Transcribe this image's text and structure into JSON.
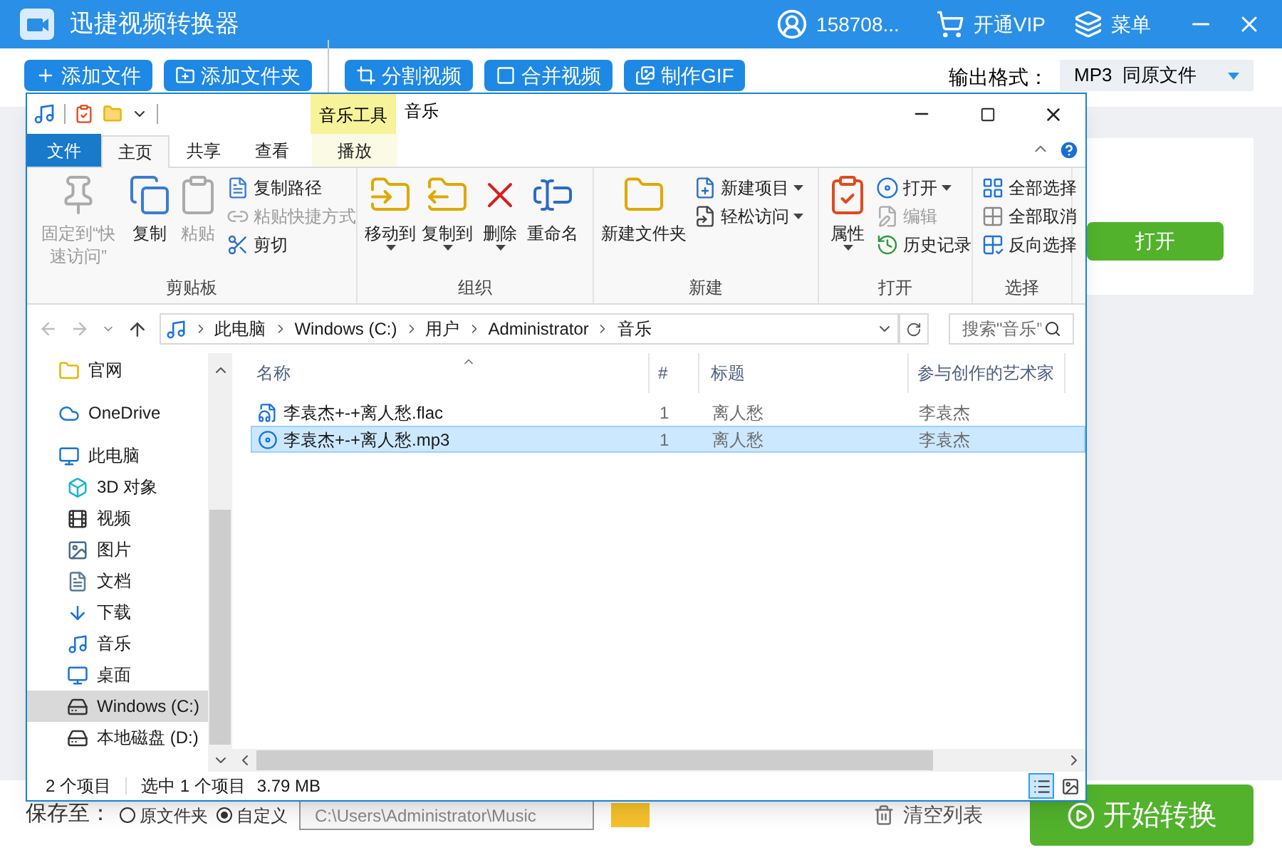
{
  "app": {
    "title": "迅捷视频转换器",
    "user": "158708...",
    "vip": "开通VIP",
    "menu": "菜单",
    "toolbar": [
      "添加文件",
      "添加文件夹",
      "分割视频",
      "合并视频",
      "制作GIF"
    ],
    "output_format": {
      "label": "输出格式：",
      "value": "MP3  同原文件"
    },
    "open_button": "打开",
    "save": {
      "label": "保存至：",
      "options": [
        {
          "label": "原文件夹",
          "selected": false
        },
        {
          "label": "自定义",
          "selected": true
        }
      ],
      "path": "C:\\Users\\Administrator\\Music"
    },
    "clear": "清空列表",
    "start": "开始转换"
  },
  "explorer": {
    "context_tab": "音乐工具",
    "title": "音乐",
    "tabs": [
      {
        "label": "文件",
        "kind": "file",
        "selected": false
      },
      {
        "label": "主页",
        "kind": "tab",
        "selected": true
      },
      {
        "label": "共享",
        "kind": "tab",
        "selected": false
      },
      {
        "label": "查看",
        "kind": "tab",
        "selected": false
      },
      {
        "label": "播放",
        "kind": "context",
        "selected": false
      }
    ],
    "ribbon": [
      {
        "label": "剪贴板",
        "items": [
          {
            "label": "固定到“快速访问”",
            "kind": "large",
            "disabled": true,
            "dropdown": false
          },
          {
            "label": "复制",
            "kind": "large",
            "disabled": false,
            "dropdown": false
          },
          {
            "label": "粘贴",
            "kind": "large",
            "disabled": true,
            "dropdown": false
          },
          {
            "label": "复制路径",
            "kind": "small",
            "disabled": false,
            "dropdown": false
          },
          {
            "label": "粘贴快捷方式",
            "kind": "small",
            "disabled": true,
            "dropdown": false
          },
          {
            "label": "剪切",
            "kind": "small",
            "disabled": false,
            "dropdown": false
          }
        ]
      },
      {
        "label": "组织",
        "items": [
          {
            "label": "移动到",
            "kind": "large",
            "disabled": false,
            "dropdown": true
          },
          {
            "label": "复制到",
            "kind": "large",
            "disabled": false,
            "dropdown": true
          },
          {
            "label": "删除",
            "kind": "large",
            "disabled": false,
            "dropdown": true
          },
          {
            "label": "重命名",
            "kind": "large",
            "disabled": false,
            "dropdown": false
          }
        ]
      },
      {
        "label": "新建",
        "items": [
          {
            "label": "新建文件夹",
            "kind": "large",
            "disabled": false,
            "dropdown": false
          },
          {
            "label": "新建项目",
            "kind": "small",
            "disabled": false,
            "dropdown": true
          },
          {
            "label": "轻松访问",
            "kind": "small",
            "disabled": false,
            "dropdown": true
          }
        ]
      },
      {
        "label": "打开",
        "items": [
          {
            "label": "属性",
            "kind": "large",
            "disabled": false,
            "dropdown": true
          },
          {
            "label": "打开",
            "kind": "small",
            "disabled": false,
            "dropdown": true
          },
          {
            "label": "编辑",
            "kind": "small",
            "disabled": true,
            "dropdown": false
          },
          {
            "label": "历史记录",
            "kind": "small",
            "disabled": false,
            "dropdown": false
          }
        ]
      },
      {
        "label": "选择",
        "items": [
          {
            "label": "全部选择",
            "kind": "small",
            "disabled": false,
            "dropdown": false
          },
          {
            "label": "全部取消",
            "kind": "small",
            "disabled": false,
            "dropdown": false
          },
          {
            "label": "反向选择",
            "kind": "small",
            "disabled": false,
            "dropdown": false
          }
        ]
      }
    ],
    "path": [
      "此电脑",
      "Windows (C:)",
      "用户",
      "Administrator",
      "音乐"
    ],
    "search_placeholder": "搜索\"音乐\"",
    "sidebar": [
      {
        "label": "官网",
        "selected": false
      },
      {
        "label": "OneDrive",
        "selected": false
      },
      {
        "label": "此电脑",
        "selected": false,
        "children": [
          {
            "label": "3D 对象",
            "selected": false
          },
          {
            "label": "视频",
            "selected": false
          },
          {
            "label": "图片",
            "selected": false
          },
          {
            "label": "文档",
            "selected": false
          },
          {
            "label": "下载",
            "selected": false
          },
          {
            "label": "音乐",
            "selected": false
          },
          {
            "label": "桌面",
            "selected": false
          },
          {
            "label": "Windows (C:)",
            "selected": true
          },
          {
            "label": "本地磁盘 (D:)",
            "selected": false
          }
        ]
      }
    ],
    "columns": [
      "名称",
      "#",
      "标题",
      "参与创作的艺术家"
    ],
    "rows": [
      {
        "cells": [
          "李袁杰+-+离人愁.flac",
          "1",
          "离人愁",
          "李袁杰"
        ],
        "selected": false
      },
      {
        "cells": [
          "李袁杰+-+离人愁.mp3",
          "1",
          "离人愁",
          "李袁杰"
        ],
        "selected": true
      }
    ],
    "status": {
      "count": "2 个项目",
      "selection": "选中 1 个项目",
      "size": "3.79 MB",
      "views": [
        {
          "selected": true
        },
        {
          "selected": false
        }
      ]
    }
  }
}
